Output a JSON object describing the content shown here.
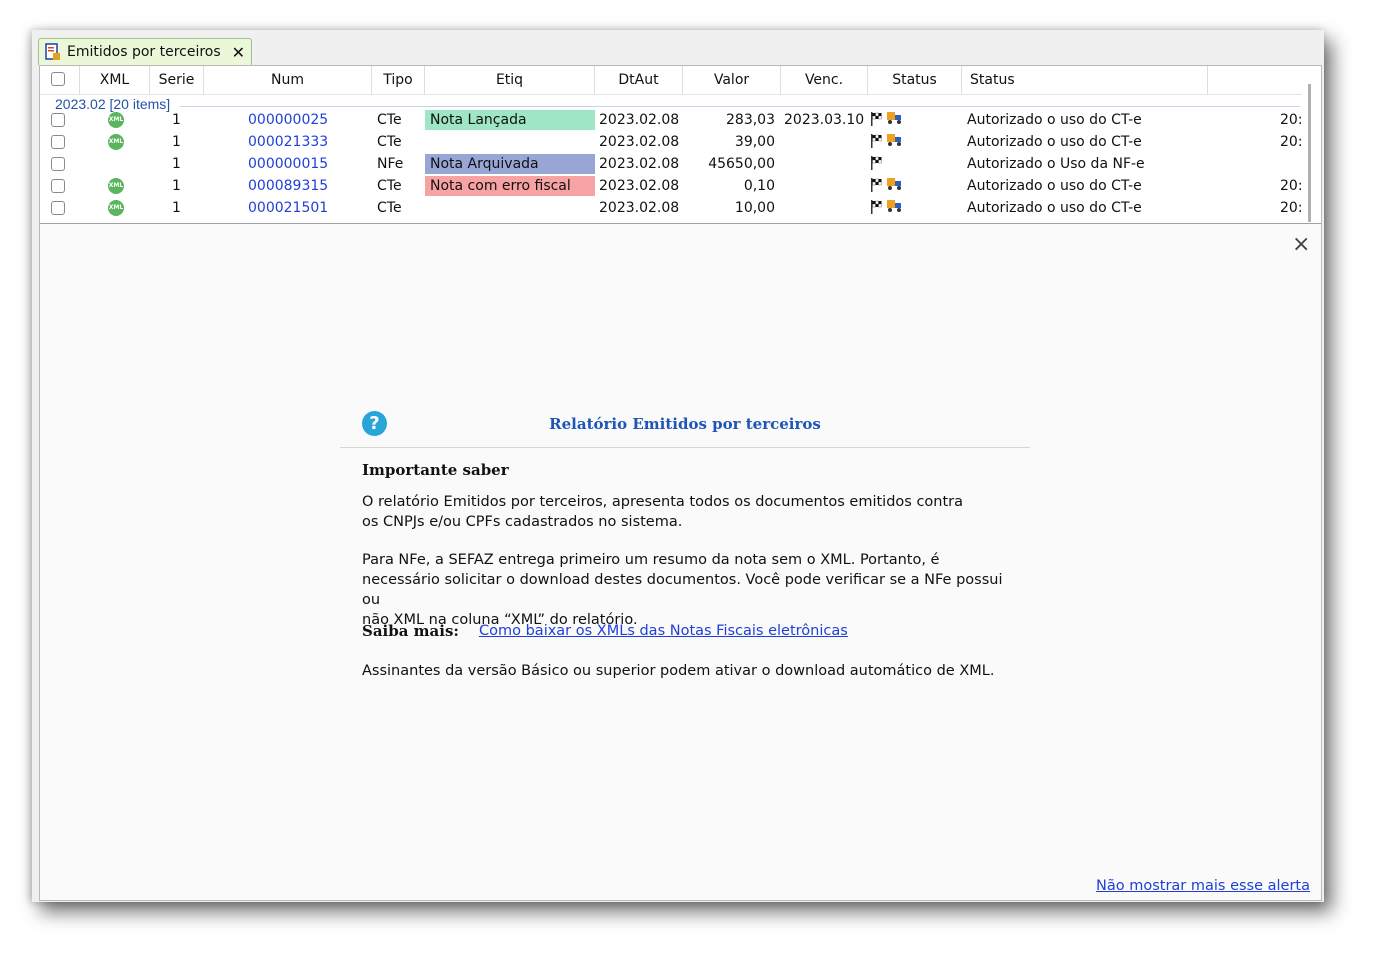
{
  "tab": {
    "title": "Emitidos por terceiros",
    "close": "✕"
  },
  "grid": {
    "headers": [
      "XML",
      "Serie",
      "Num",
      "Tipo",
      "Etiq",
      "DtAut",
      "Valor",
      "Venc.",
      "Status",
      "Status"
    ],
    "group": "2023.02 [20 items]",
    "rows": [
      {
        "xml": true,
        "serie": "1",
        "num": "000000025",
        "tipo": "CTe",
        "etiq": "Nota Lançada",
        "etiq_color": "#9ee6c4",
        "dtaut": "2023.02.08",
        "valor": "283,03",
        "venc": "2023.03.10",
        "truck": true,
        "status": "Autorizado o uso do CT-e",
        "extra": "20:"
      },
      {
        "xml": true,
        "serie": "1",
        "num": "000021333",
        "tipo": "CTe",
        "etiq": "",
        "etiq_color": "",
        "dtaut": "2023.02.08",
        "valor": "39,00",
        "venc": "",
        "truck": true,
        "status": "Autorizado o uso do CT-e",
        "extra": "20:"
      },
      {
        "xml": false,
        "serie": "1",
        "num": "000000015",
        "tipo": "NFe",
        "etiq": "Nota Arquivada",
        "etiq_color": "#98a6d6",
        "dtaut": "2023.02.08",
        "valor": "45650,00",
        "venc": "",
        "truck": false,
        "status": "Autorizado o Uso da NF-e",
        "extra": ""
      },
      {
        "xml": true,
        "serie": "1",
        "num": "000089315",
        "tipo": "CTe",
        "etiq": "Nota com erro fiscal",
        "etiq_color": "#f7a3a3",
        "dtaut": "2023.02.08",
        "valor": "0,10",
        "venc": "",
        "truck": true,
        "status": "Autorizado o uso do CT-e",
        "extra": "20:"
      },
      {
        "xml": true,
        "serie": "1",
        "num": "000021501",
        "tipo": "CTe",
        "etiq": "",
        "etiq_color": "",
        "dtaut": "2023.02.08",
        "valor": "10,00",
        "venc": "",
        "truck": true,
        "status": "Autorizado o uso do CT-e",
        "extra": "20:"
      }
    ]
  },
  "alert": {
    "close": "×",
    "title": "Relatório Emitidos por terceiros",
    "heading": "Importante saber",
    "p1_line1": "O relatório Emitidos por terceiros, apresenta todos os documentos emitidos contra",
    "p1_line2": "os CNPJs e/ou CPFs cadastrados no sistema.",
    "p2_line1": "Para NFe, a SEFAZ entrega primeiro um resumo da nota sem o XML. Portanto, é",
    "p2_line2": "necessário solicitar o download destes documentos. Você pode verificar se a NFe possui ou",
    "p2_line3": "não XML na coluna “XML” do relatório.",
    "more_label": "Saiba mais:",
    "more_link": "Como baixar os XMLs das Notas Fiscais eletrônicas",
    "p3": "Assinantes da versão Básico ou superior podem ativar o download automático de XML.",
    "dont_show": "Não mostrar mais esse alerta"
  }
}
